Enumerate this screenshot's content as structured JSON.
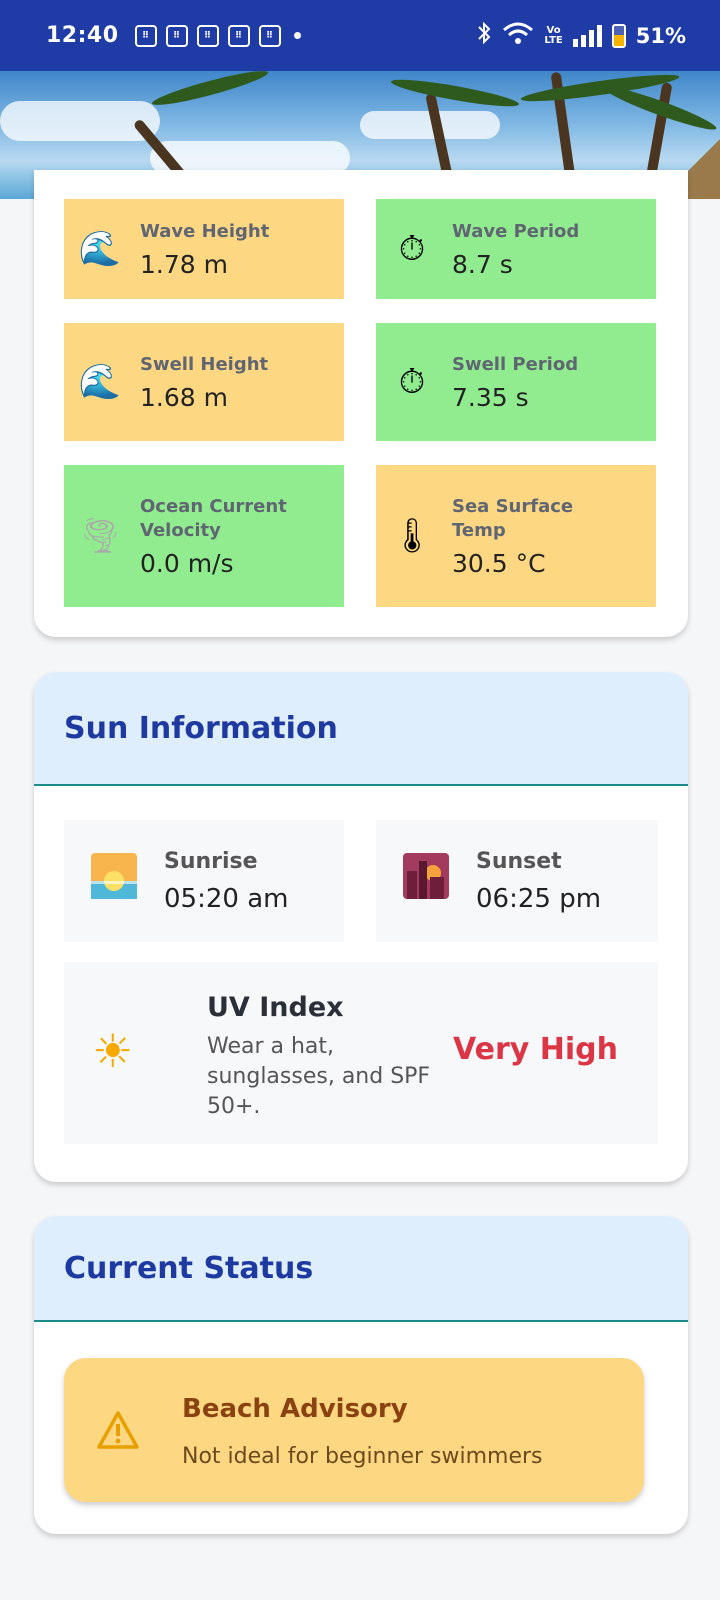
{
  "status_bar": {
    "time": "12:40",
    "battery": "51%",
    "battery_level": 0.51,
    "lte_label": "Vo\nLTE"
  },
  "conditions": {
    "tiles": [
      {
        "label": "Wave Height",
        "value": "1.78 m",
        "icon": "wave-icon",
        "color": "#fed782"
      },
      {
        "label": "Wave Period",
        "value": "8.7 s",
        "icon": "stopwatch-icon",
        "color": "#91ec8f"
      },
      {
        "label": "Swell Height",
        "value": "1.68 m",
        "icon": "wave-icon",
        "color": "#fed782"
      },
      {
        "label": "Swell Period",
        "value": "7.35 s",
        "icon": "stopwatch-icon",
        "color": "#91ec8f"
      },
      {
        "label": "Ocean Current Velocity",
        "value": "0.0 m/s",
        "icon": "tornado-icon",
        "color": "#91ec8f"
      },
      {
        "label": "Sea Surface Temp",
        "value": "30.5 °C",
        "icon": "thermometer-icon",
        "color": "#fed782"
      }
    ]
  },
  "sun": {
    "title": "Sun Information",
    "sunrise_label": "Sunrise",
    "sunrise_value": "05:20 am",
    "sunset_label": "Sunset",
    "sunset_value": "06:25 pm",
    "uv_title": "UV Index",
    "uv_desc": "Wear a hat, sunglasses, and SPF 50+.",
    "uv_level": "Very High"
  },
  "status": {
    "title": "Current Status",
    "advisory_title": "Beach Advisory",
    "advisory_text": "Not ideal for beginner swimmers"
  }
}
